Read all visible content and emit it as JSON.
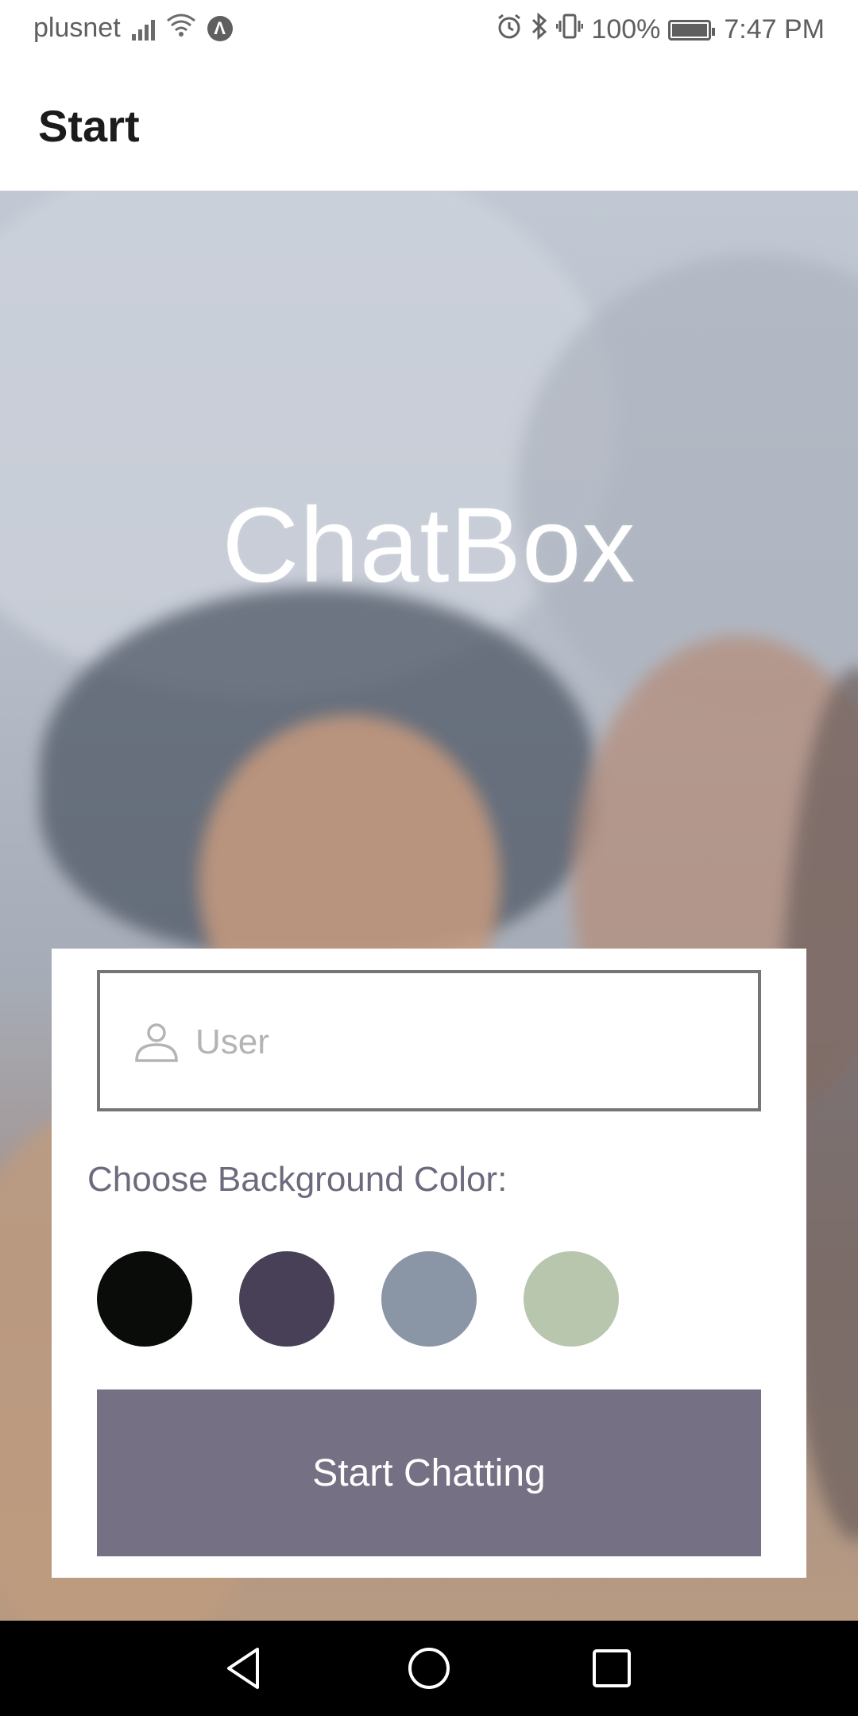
{
  "status_bar": {
    "carrier": "plusnet",
    "battery": "100%",
    "time": "7:47 PM",
    "icons": [
      "signal-icon",
      "wifi-icon",
      "arrow-a-icon",
      "alarm-icon",
      "bluetooth-icon",
      "vibrate-icon",
      "battery-icon"
    ]
  },
  "app_bar": {
    "title": "Start"
  },
  "hero": {
    "app_name": "ChatBox"
  },
  "form": {
    "user_placeholder": "User",
    "user_value": "",
    "color_label": "Choose Background Color:",
    "colors": [
      {
        "name": "black",
        "hex": "#090C08"
      },
      {
        "name": "purple",
        "hex": "#474056"
      },
      {
        "name": "slate",
        "hex": "#8A95A5"
      },
      {
        "name": "sage",
        "hex": "#B9C6AE"
      }
    ],
    "start_button": "Start Chatting",
    "button_color": "#757083"
  },
  "nav_bar": {
    "icons": [
      "back-icon",
      "home-icon",
      "recents-icon"
    ]
  }
}
